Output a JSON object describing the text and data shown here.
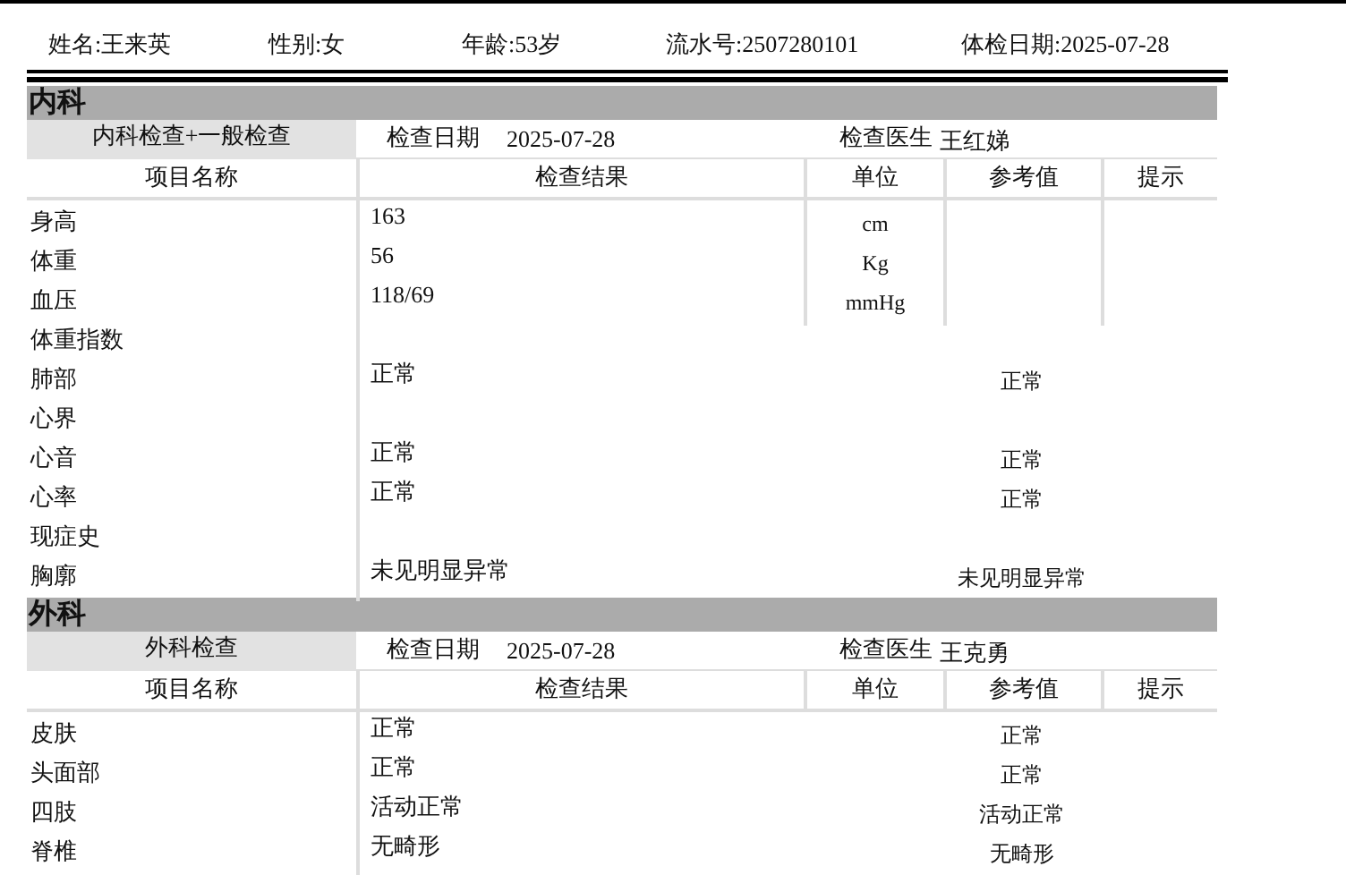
{
  "patient": [
    {
      "label": "姓名:",
      "value": "王来英"
    },
    {
      "label": "性别:",
      "value": "女"
    },
    {
      "label": "年龄:",
      "value": "53岁"
    },
    {
      "label": "流水号:",
      "value": "2507280101"
    },
    {
      "label": "体检日期:",
      "value": "2025-07-28"
    }
  ],
  "sections": [
    {
      "title": "内科",
      "exam_name": "内科检查+一般检查",
      "date_label": "检查日期",
      "date": "2025-07-28",
      "doctor_label": "检查医生",
      "doctor": "王红娣",
      "columns": [
        "项目名称",
        "检查结果",
        "单位",
        "参考值",
        "提示"
      ],
      "rows": [
        {
          "name": "身高",
          "result": "163",
          "unit": "cm"
        },
        {
          "name": "体重",
          "result": "56",
          "unit": "Kg"
        },
        {
          "name": "血压",
          "result": "118/69",
          "unit": "mmHg"
        },
        {
          "name": "体重指数"
        },
        {
          "name": "肺部",
          "result": "正常",
          "reference": "正常"
        },
        {
          "name": "心界"
        },
        {
          "name": "心音",
          "result": "正常",
          "reference": "正常"
        },
        {
          "name": "心率",
          "result": "正常",
          "reference": "正常"
        },
        {
          "name": "现症史"
        },
        {
          "name": "胸廓",
          "result": "未见明显异常",
          "reference": "未见明显异常"
        }
      ]
    },
    {
      "title": "外科",
      "exam_name": "外科检查",
      "date_label": "检查日期",
      "date": "2025-07-28",
      "doctor_label": "检查医生",
      "doctor": "王克勇",
      "columns": [
        "项目名称",
        "检查结果",
        "单位",
        "参考值",
        "提示"
      ],
      "rows": [
        {
          "name": "皮肤",
          "result": "正常",
          "reference": "正常"
        },
        {
          "name": "头面部",
          "result": "正常",
          "reference": "正常"
        },
        {
          "name": "四肢",
          "result": "活动正常",
          "reference": "活动正常"
        },
        {
          "name": "脊椎",
          "result": "无畸形",
          "reference": "无畸形"
        }
      ]
    }
  ]
}
